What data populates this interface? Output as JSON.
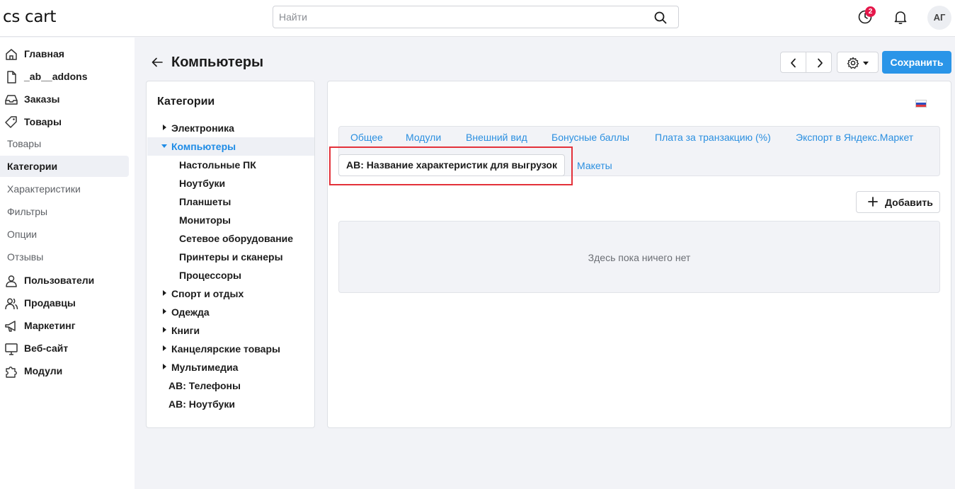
{
  "header": {
    "logo": "cs cart",
    "search_placeholder": "Найти",
    "notification_badge": "2",
    "avatar_initials": "АГ"
  },
  "sidebar": {
    "items": [
      {
        "label": "Главная",
        "icon": "home-icon"
      },
      {
        "label": "_ab__addons",
        "icon": "file-icon"
      },
      {
        "label": "Заказы",
        "icon": "inbox-icon"
      },
      {
        "label": "Товары",
        "icon": "tag-icon"
      }
    ],
    "products_sub": [
      "Товары",
      "Категории",
      "Характеристики",
      "Фильтры",
      "Опции",
      "Отзывы"
    ],
    "active_sub": "Категории",
    "items_after": [
      {
        "label": "Пользователи",
        "icon": "user-icon"
      },
      {
        "label": "Продавцы",
        "icon": "users-icon"
      },
      {
        "label": "Маркетинг",
        "icon": "megaphone-icon"
      },
      {
        "label": "Веб-сайт",
        "icon": "monitor-icon"
      },
      {
        "label": "Модули",
        "icon": "puzzle-icon"
      }
    ]
  },
  "page": {
    "title": "Компьютеры",
    "save_label": "Сохранить"
  },
  "categories": {
    "title": "Категории",
    "tree": [
      {
        "label": "Электроника",
        "caret": "right",
        "level": 0
      },
      {
        "label": "Компьютеры",
        "caret": "down",
        "level": 0,
        "active": true
      },
      {
        "label": "Настольные ПК",
        "level": 1
      },
      {
        "label": "Ноутбуки",
        "level": 1
      },
      {
        "label": "Планшеты",
        "level": 1
      },
      {
        "label": "Мониторы",
        "level": 1
      },
      {
        "label": "Сетевое оборудование",
        "level": 1
      },
      {
        "label": "Принтеры и сканеры",
        "level": 1
      },
      {
        "label": "Процессоры",
        "level": 1
      },
      {
        "label": "Спорт и отдых",
        "caret": "right",
        "level": 0
      },
      {
        "label": "Одежда",
        "caret": "right",
        "level": 0
      },
      {
        "label": "Книги",
        "caret": "right",
        "level": 0
      },
      {
        "label": "Канцелярские товары",
        "caret": "right",
        "level": 0
      },
      {
        "label": "Мультимедиа",
        "caret": "right",
        "level": 0
      },
      {
        "label": "AB: Телефоны",
        "level": 0
      },
      {
        "label": "AB: Ноутбуки",
        "level": 0
      }
    ]
  },
  "tabs": {
    "row1": [
      "Общее",
      "Модули",
      "Внешний вид",
      "Бонусные баллы",
      "Плата за транзакцию (%)",
      "Экспорт в Яндекс.Маркет"
    ],
    "active": "AB: Название характеристик для выгрузок",
    "row2_after": "Макеты"
  },
  "content": {
    "add_label": "Добавить",
    "empty_text": "Здесь пока ничего нет"
  },
  "colors": {
    "accent": "#2a95e8",
    "link": "#2a8fe0",
    "highlight": "#e3313a",
    "badge": "#e5174a"
  }
}
